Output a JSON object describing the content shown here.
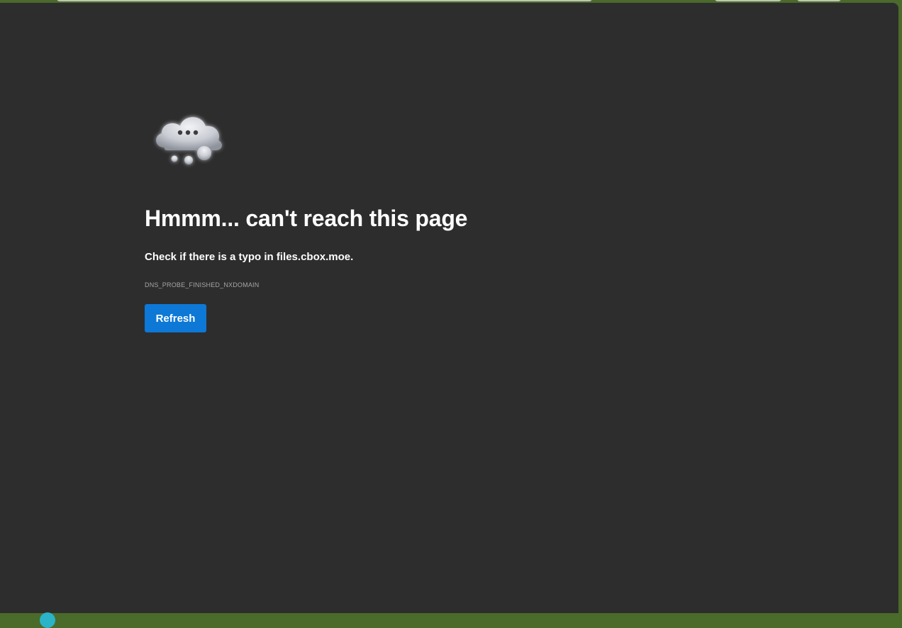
{
  "error_page": {
    "heading": "Hmmm... can't reach this page",
    "subtitle": "Check if there is a typo in files.cbox.moe.",
    "error_code": "DNS_PROBE_FINISHED_NXDOMAIN",
    "refresh_label": "Refresh",
    "icon": "cloud-thinking-icon"
  },
  "colors": {
    "page_background": "#2d2d2d",
    "frame": "#4b6a2b",
    "button": "#0d78d6",
    "text": "#ffffff",
    "muted_text": "#a6a6a6"
  }
}
